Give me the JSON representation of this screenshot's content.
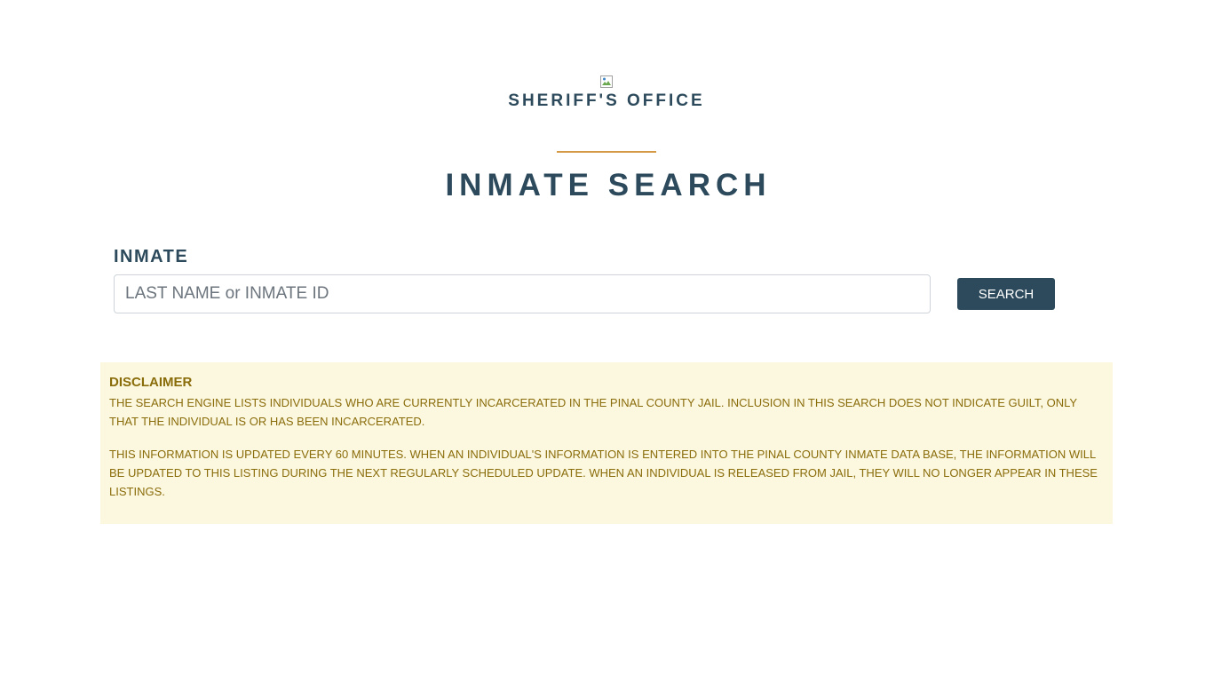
{
  "header": {
    "logo_icon": "broken-image-icon",
    "office_title": "SHERIFF'S OFFICE"
  },
  "page_title": "INMATE SEARCH",
  "search": {
    "label": "INMATE",
    "placeholder": "LAST NAME or INMATE ID",
    "value": "",
    "button_label": "SEARCH"
  },
  "disclaimer": {
    "heading": "DISCLAIMER",
    "paragraphs": [
      "THE SEARCH ENGINE LISTS INDIVIDUALS WHO ARE CURRENTLY INCARCERATED IN THE PINAL COUNTY JAIL. INCLUSION IN THIS SEARCH DOES NOT INDICATE GUILT, ONLY THAT THE INDIVIDUAL IS OR HAS BEEN INCARCERATED.",
      "THIS INFORMATION IS UPDATED EVERY 60 MINUTES. WHEN AN INDIVIDUAL'S INFORMATION IS ENTERED INTO THE PINAL COUNTY INMATE DATA BASE, THE INFORMATION WILL BE UPDATED TO THIS LISTING DURING THE NEXT REGULARLY SCHEDULED UPDATE. WHEN AN INDIVIDUAL IS RELEASED FROM JAIL, THEY WILL NO LONGER APPEAR IN THESE LISTINGS."
    ]
  },
  "colors": {
    "primary": "#2c4a5b",
    "accent": "#d49a45",
    "disclaimer_bg": "#fcf7df",
    "disclaimer_text": "#8a6d0b"
  }
}
